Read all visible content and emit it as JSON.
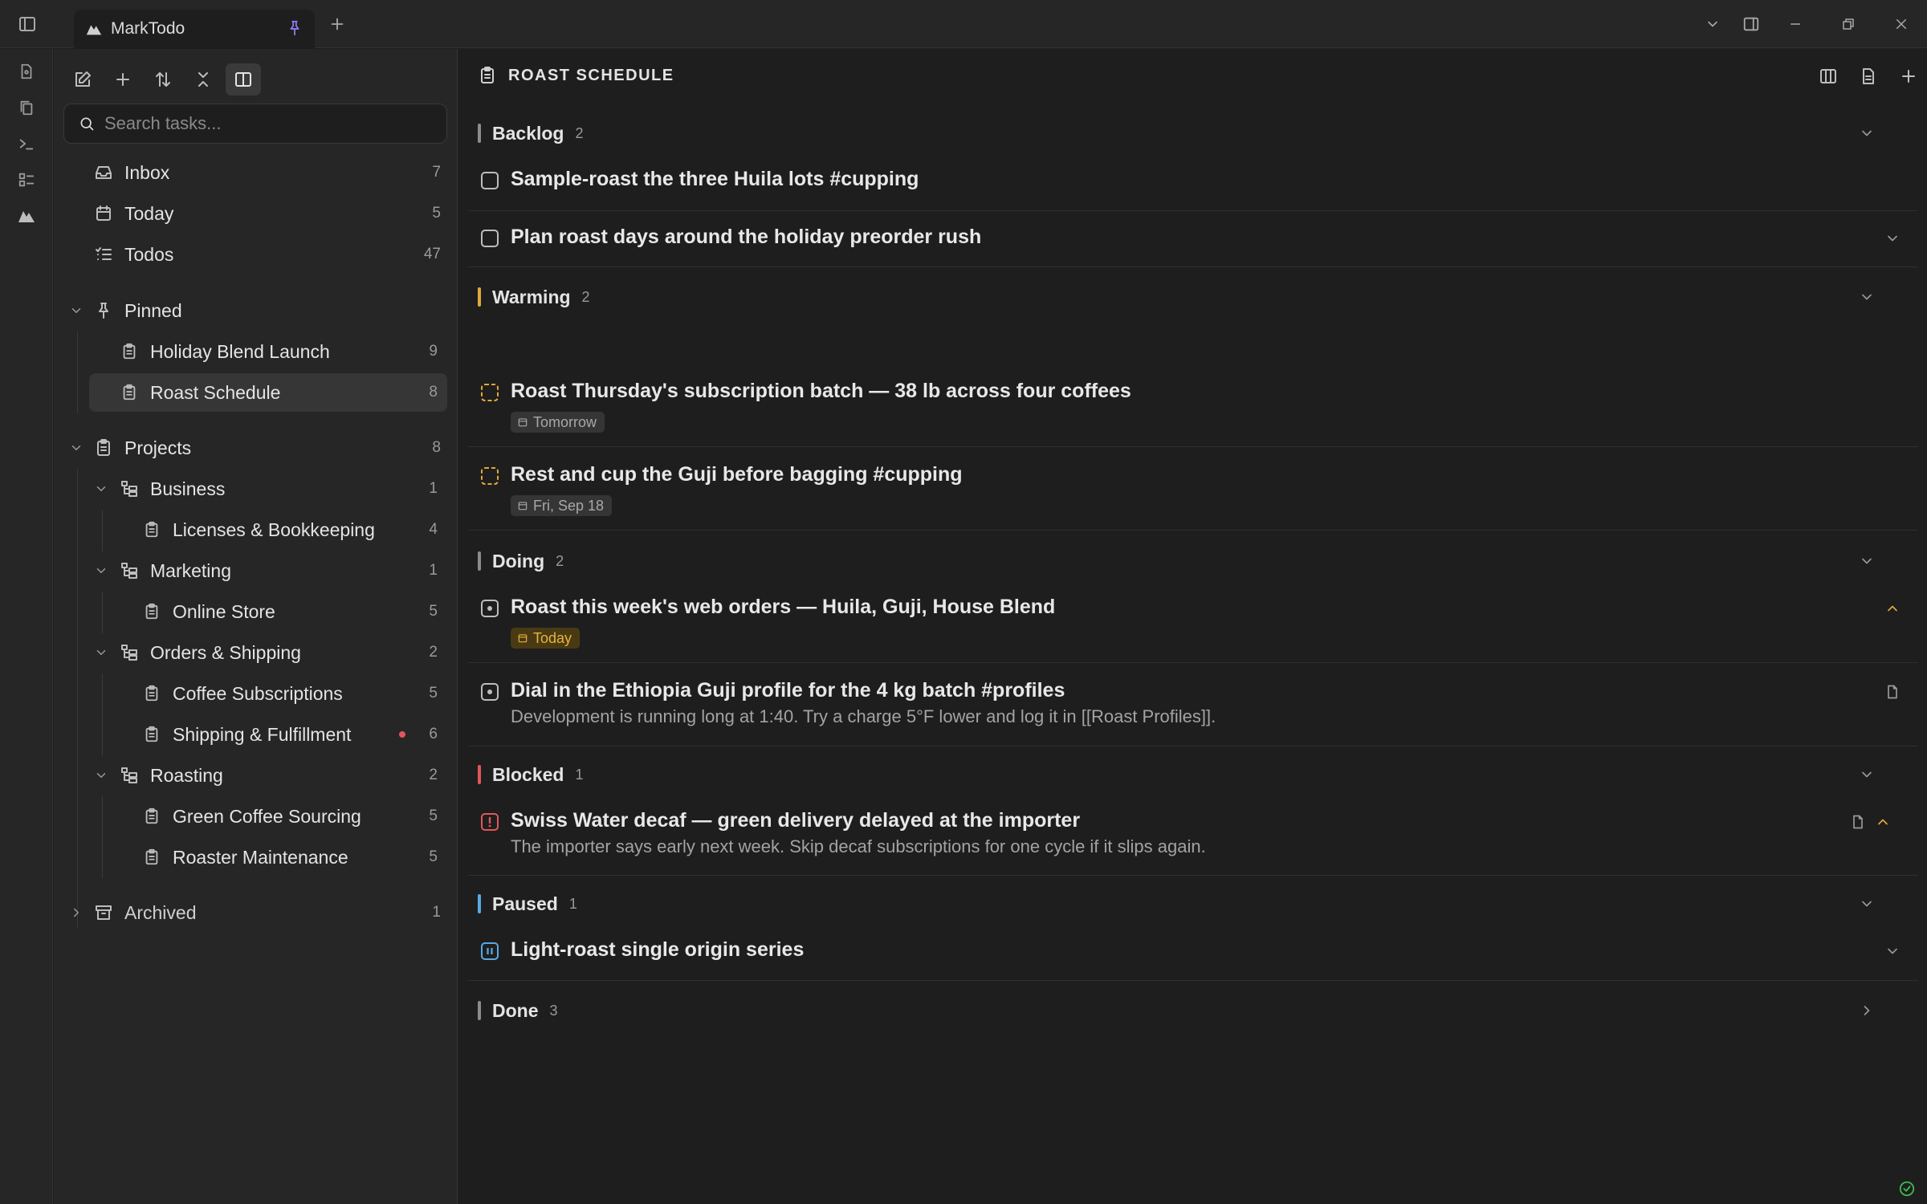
{
  "app": {
    "tab_title": "MarkTodo"
  },
  "sidebar": {
    "search_placeholder": "Search tasks...",
    "top_items": [
      {
        "label": "Inbox",
        "count": "7"
      },
      {
        "label": "Today",
        "count": "5"
      },
      {
        "label": "Todos",
        "count": "47"
      }
    ],
    "pinned": {
      "label": "Pinned",
      "items": [
        {
          "label": "Holiday Blend Launch",
          "count": "9"
        },
        {
          "label": "Roast Schedule",
          "count": "8"
        }
      ]
    },
    "projects": {
      "label": "Projects",
      "count": "8",
      "folders": [
        {
          "label": "Business",
          "count": "1",
          "items": [
            {
              "label": "Licenses & Bookkeeping",
              "count": "4"
            }
          ]
        },
        {
          "label": "Marketing",
          "count": "1",
          "items": [
            {
              "label": "Online Store",
              "count": "5"
            }
          ]
        },
        {
          "label": "Orders & Shipping",
          "count": "2",
          "items": [
            {
              "label": "Coffee Subscriptions",
              "count": "5"
            },
            {
              "label": "Shipping & Fulfillment",
              "count": "6"
            }
          ]
        },
        {
          "label": "Roasting",
          "count": "2",
          "items": [
            {
              "label": "Green Coffee Sourcing",
              "count": "5"
            },
            {
              "label": "Roaster Maintenance",
              "count": "5"
            }
          ]
        }
      ]
    },
    "archived": {
      "label": "Archived",
      "count": "1"
    }
  },
  "main": {
    "title": "ROAST SCHEDULE",
    "groups": [
      {
        "name": "Backlog",
        "count": "2",
        "color": "#8c8c8c"
      },
      {
        "name": "Warming",
        "count": "2",
        "color": "#e2a93b"
      },
      {
        "name": "Doing",
        "count": "2",
        "color": "#8c8c8c"
      },
      {
        "name": "Blocked",
        "count": "1",
        "color": "#e0575b"
      },
      {
        "name": "Paused",
        "count": "1",
        "color": "#5aa9e6"
      },
      {
        "name": "Done",
        "count": "3",
        "color": "#8c8c8c"
      }
    ],
    "tasks": {
      "backlog": [
        {
          "title": "Sample-roast the three Huila lots #cupping"
        },
        {
          "title": "Plan roast days around the holiday preorder rush"
        }
      ],
      "warming": [
        {
          "title": "Roast Thursday's subscription batch — 38 lb across four coffees",
          "date": "Tomorrow"
        },
        {
          "title": "Rest and cup the Guji before bagging #cupping",
          "date": "Fri, Sep 18"
        }
      ],
      "doing": [
        {
          "title": "Roast this week's web orders — Huila, Guji, House Blend",
          "date": "Today"
        },
        {
          "title": "Dial in the Ethiopia Guji profile for the 4 kg batch #profiles",
          "note": "Development is running long at 1:40. Try a charge 5°F lower and log it in [[Roast Profiles]]."
        }
      ],
      "blocked": [
        {
          "title": "Swiss Water decaf — green delivery delayed at the importer",
          "note": "The importer says early next week. Skip decaf subscriptions for one cycle if it slips again."
        }
      ],
      "paused": [
        {
          "title": "Light-roast single origin series"
        }
      ]
    }
  },
  "colors": {
    "accent": "#8a7cf0",
    "warming": "#e2a93b",
    "blocked": "#e0575b",
    "paused": "#5aa9e6",
    "today_badge": "#e6b43c",
    "ok": "#3fb950"
  }
}
